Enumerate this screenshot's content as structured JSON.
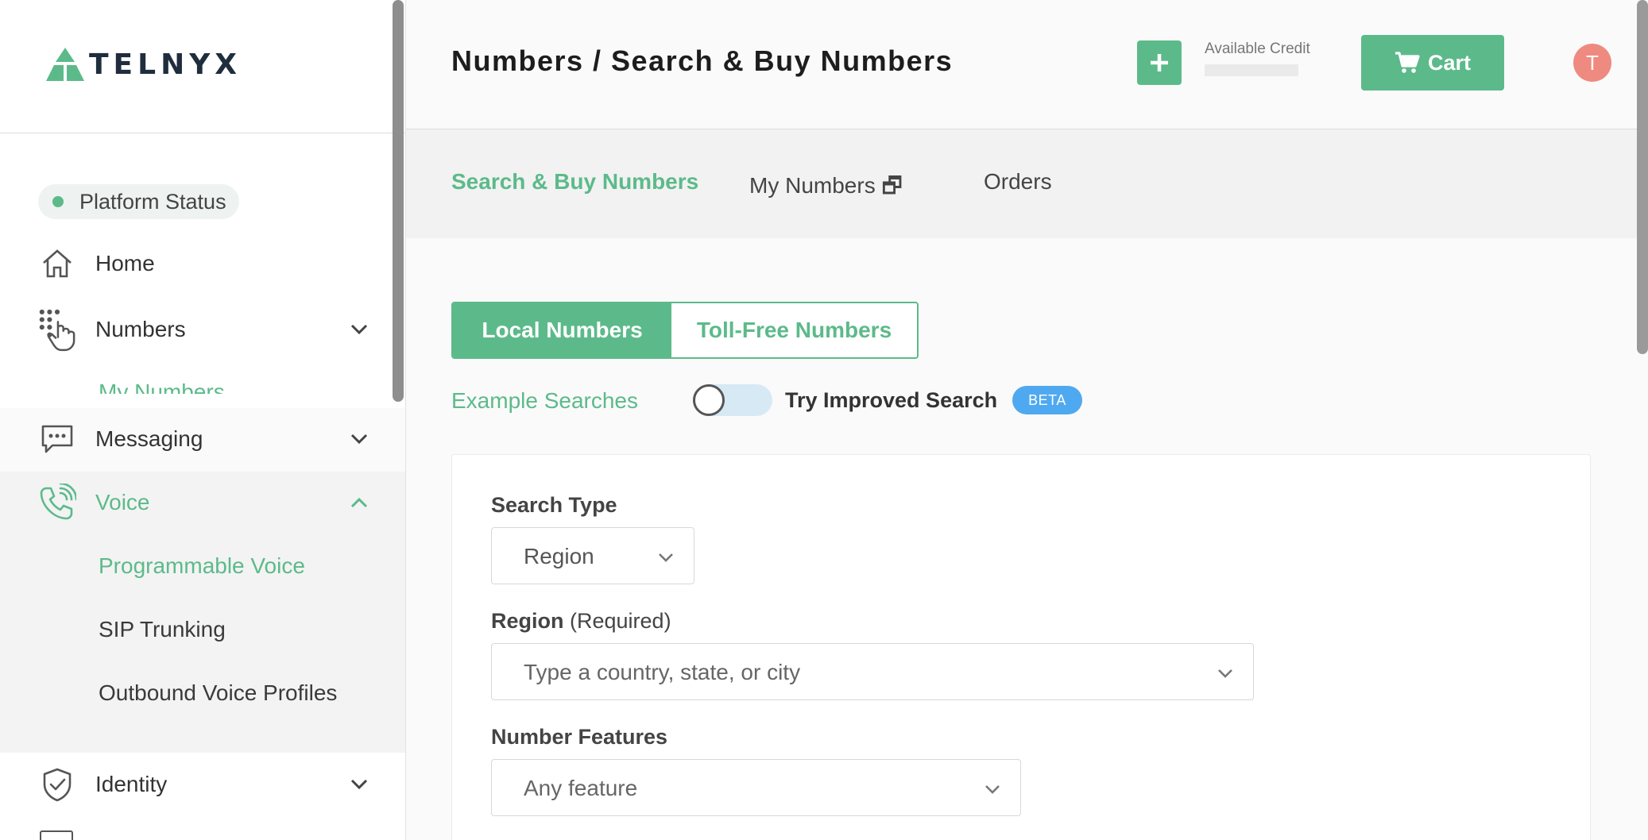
{
  "brand": {
    "name": "TELNYX",
    "accent": "#5cba8a"
  },
  "sidebar": {
    "platform_status": "Platform Status",
    "items": [
      {
        "label": "Home",
        "icon": "home-icon"
      },
      {
        "label": "Numbers",
        "icon": "dialpad-icon",
        "sub_partial": "My Numbers"
      },
      {
        "label": "Messaging",
        "icon": "message-icon"
      },
      {
        "label": "Voice",
        "icon": "phone-icon",
        "sub": [
          "Programmable Voice",
          "SIP Trunking",
          "Outbound Voice Profiles"
        ]
      },
      {
        "label": "Identity",
        "icon": "shield-check-icon"
      }
    ]
  },
  "header": {
    "title": "Numbers / Search & Buy Numbers",
    "credit_label": "Available Credit",
    "cart_label": "Cart",
    "avatar_initial": "T"
  },
  "tabs": [
    {
      "label": "Search & Buy Numbers",
      "active": true
    },
    {
      "label": "My Numbers 🗗",
      "active": false
    },
    {
      "label": "Orders",
      "active": false
    }
  ],
  "number_type": {
    "local": "Local Numbers",
    "toll_free": "Toll-Free Numbers",
    "selected": "Local Numbers"
  },
  "search_options": {
    "example_link": "Example Searches",
    "improved_label": "Try Improved Search",
    "improved_on": false,
    "beta_badge": "BETA"
  },
  "form": {
    "search_type_label": "Search Type",
    "search_type_value": "Region",
    "region_label": "Region",
    "region_required": "(Required)",
    "region_placeholder": "Type a country, state, or city",
    "features_label": "Number Features",
    "features_value": "Any feature"
  }
}
